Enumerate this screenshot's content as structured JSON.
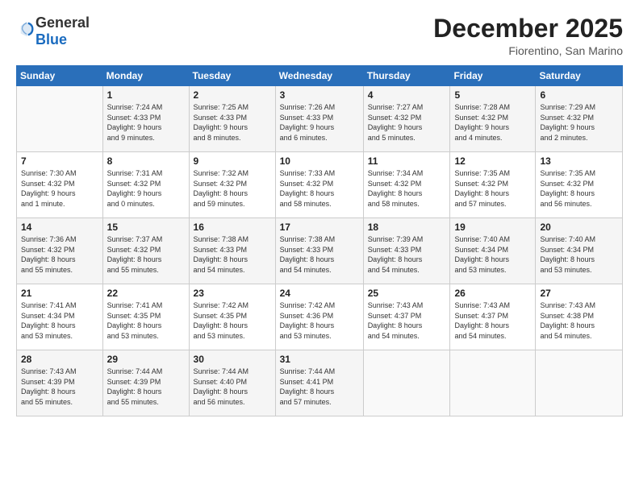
{
  "logo": {
    "general": "General",
    "blue": "Blue"
  },
  "header": {
    "title": "December 2025",
    "location": "Fiorentino, San Marino"
  },
  "weekdays": [
    "Sunday",
    "Monday",
    "Tuesday",
    "Wednesday",
    "Thursday",
    "Friday",
    "Saturday"
  ],
  "weeks": [
    [
      {
        "day": "",
        "info": ""
      },
      {
        "day": "1",
        "info": "Sunrise: 7:24 AM\nSunset: 4:33 PM\nDaylight: 9 hours\nand 9 minutes."
      },
      {
        "day": "2",
        "info": "Sunrise: 7:25 AM\nSunset: 4:33 PM\nDaylight: 9 hours\nand 8 minutes."
      },
      {
        "day": "3",
        "info": "Sunrise: 7:26 AM\nSunset: 4:33 PM\nDaylight: 9 hours\nand 6 minutes."
      },
      {
        "day": "4",
        "info": "Sunrise: 7:27 AM\nSunset: 4:32 PM\nDaylight: 9 hours\nand 5 minutes."
      },
      {
        "day": "5",
        "info": "Sunrise: 7:28 AM\nSunset: 4:32 PM\nDaylight: 9 hours\nand 4 minutes."
      },
      {
        "day": "6",
        "info": "Sunrise: 7:29 AM\nSunset: 4:32 PM\nDaylight: 9 hours\nand 2 minutes."
      }
    ],
    [
      {
        "day": "7",
        "info": "Sunrise: 7:30 AM\nSunset: 4:32 PM\nDaylight: 9 hours\nand 1 minute."
      },
      {
        "day": "8",
        "info": "Sunrise: 7:31 AM\nSunset: 4:32 PM\nDaylight: 9 hours\nand 0 minutes."
      },
      {
        "day": "9",
        "info": "Sunrise: 7:32 AM\nSunset: 4:32 PM\nDaylight: 8 hours\nand 59 minutes."
      },
      {
        "day": "10",
        "info": "Sunrise: 7:33 AM\nSunset: 4:32 PM\nDaylight: 8 hours\nand 58 minutes."
      },
      {
        "day": "11",
        "info": "Sunrise: 7:34 AM\nSunset: 4:32 PM\nDaylight: 8 hours\nand 58 minutes."
      },
      {
        "day": "12",
        "info": "Sunrise: 7:35 AM\nSunset: 4:32 PM\nDaylight: 8 hours\nand 57 minutes."
      },
      {
        "day": "13",
        "info": "Sunrise: 7:35 AM\nSunset: 4:32 PM\nDaylight: 8 hours\nand 56 minutes."
      }
    ],
    [
      {
        "day": "14",
        "info": "Sunrise: 7:36 AM\nSunset: 4:32 PM\nDaylight: 8 hours\nand 55 minutes."
      },
      {
        "day": "15",
        "info": "Sunrise: 7:37 AM\nSunset: 4:32 PM\nDaylight: 8 hours\nand 55 minutes."
      },
      {
        "day": "16",
        "info": "Sunrise: 7:38 AM\nSunset: 4:33 PM\nDaylight: 8 hours\nand 54 minutes."
      },
      {
        "day": "17",
        "info": "Sunrise: 7:38 AM\nSunset: 4:33 PM\nDaylight: 8 hours\nand 54 minutes."
      },
      {
        "day": "18",
        "info": "Sunrise: 7:39 AM\nSunset: 4:33 PM\nDaylight: 8 hours\nand 54 minutes."
      },
      {
        "day": "19",
        "info": "Sunrise: 7:40 AM\nSunset: 4:34 PM\nDaylight: 8 hours\nand 53 minutes."
      },
      {
        "day": "20",
        "info": "Sunrise: 7:40 AM\nSunset: 4:34 PM\nDaylight: 8 hours\nand 53 minutes."
      }
    ],
    [
      {
        "day": "21",
        "info": "Sunrise: 7:41 AM\nSunset: 4:34 PM\nDaylight: 8 hours\nand 53 minutes."
      },
      {
        "day": "22",
        "info": "Sunrise: 7:41 AM\nSunset: 4:35 PM\nDaylight: 8 hours\nand 53 minutes."
      },
      {
        "day": "23",
        "info": "Sunrise: 7:42 AM\nSunset: 4:35 PM\nDaylight: 8 hours\nand 53 minutes."
      },
      {
        "day": "24",
        "info": "Sunrise: 7:42 AM\nSunset: 4:36 PM\nDaylight: 8 hours\nand 53 minutes."
      },
      {
        "day": "25",
        "info": "Sunrise: 7:43 AM\nSunset: 4:37 PM\nDaylight: 8 hours\nand 54 minutes."
      },
      {
        "day": "26",
        "info": "Sunrise: 7:43 AM\nSunset: 4:37 PM\nDaylight: 8 hours\nand 54 minutes."
      },
      {
        "day": "27",
        "info": "Sunrise: 7:43 AM\nSunset: 4:38 PM\nDaylight: 8 hours\nand 54 minutes."
      }
    ],
    [
      {
        "day": "28",
        "info": "Sunrise: 7:43 AM\nSunset: 4:39 PM\nDaylight: 8 hours\nand 55 minutes."
      },
      {
        "day": "29",
        "info": "Sunrise: 7:44 AM\nSunset: 4:39 PM\nDaylight: 8 hours\nand 55 minutes."
      },
      {
        "day": "30",
        "info": "Sunrise: 7:44 AM\nSunset: 4:40 PM\nDaylight: 8 hours\nand 56 minutes."
      },
      {
        "day": "31",
        "info": "Sunrise: 7:44 AM\nSunset: 4:41 PM\nDaylight: 8 hours\nand 57 minutes."
      },
      {
        "day": "",
        "info": ""
      },
      {
        "day": "",
        "info": ""
      },
      {
        "day": "",
        "info": ""
      }
    ]
  ]
}
